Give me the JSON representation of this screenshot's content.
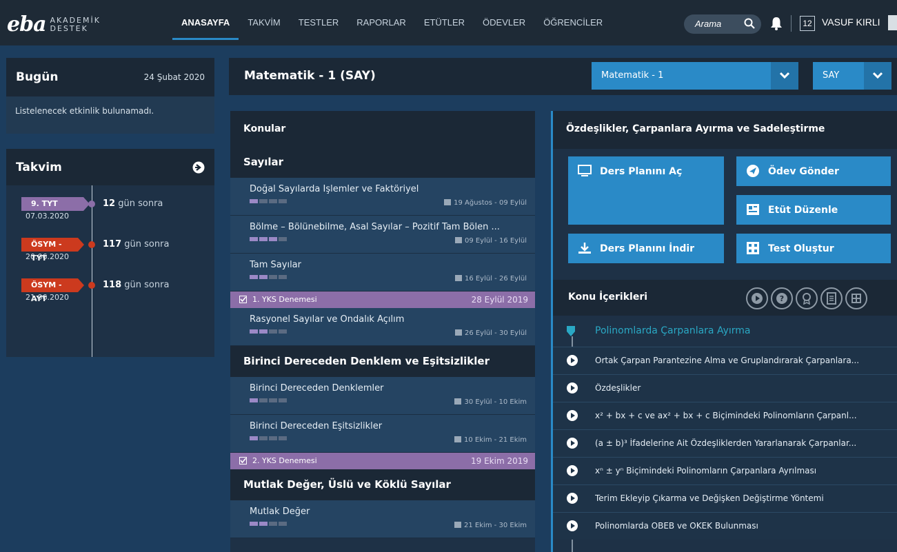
{
  "logo": {
    "mark": "eba",
    "line1": "AKADEMİK",
    "line2": "DESTEK"
  },
  "nav": [
    "ANASAYFA",
    "TAKVİM",
    "TESTLER",
    "RAPORLAR",
    "ETÜTLER",
    "ÖDEVLER",
    "ÖĞRENCİLER"
  ],
  "header": {
    "search_label": "Arama",
    "badge": "12",
    "username": "VASUF KIRLI"
  },
  "today": {
    "title": "Bugün",
    "date": "24 Şubat 2020",
    "empty": "Listelenecek etkinlik bulunamadı."
  },
  "takvim": {
    "title": "Takvim",
    "events": [
      {
        "tag": "9. TYT",
        "date": "07.03.2020",
        "days_num": "12",
        "days_suffix": "gün sonra",
        "color": "#8c6ea8"
      },
      {
        "tag": "ÖSYM - TYT",
        "date": "20.06.2020",
        "days_num": "117",
        "days_suffix": "gün sonra",
        "color": "#cc3a1e"
      },
      {
        "tag": "ÖSYM - AYT",
        "date": "21.06.2020",
        "days_num": "118",
        "days_suffix": "gün sonra",
        "color": "#cc3a1e"
      }
    ]
  },
  "subject": {
    "title": "Matematik - 1 (SAY)",
    "select1": "Matematik - 1",
    "select2": "SAY"
  },
  "konular": {
    "title": "Konular",
    "sections": [
      {
        "title": "Sayılar",
        "items": [
          {
            "type": "topic",
            "name": "Doğal Sayılarda İşlemler ve Faktöriyel",
            "progress": 1,
            "date": "19 Ağustos - 09 Eylül"
          },
          {
            "type": "topic",
            "name": "Bölme – Bölünebilme, Asal Sayılar – Pozitif Tam Bölen ...",
            "progress": 3,
            "date": "09 Eylül - 16 Eylül"
          },
          {
            "type": "topic",
            "name": "Tam Sayılar",
            "progress": 2,
            "date": "16 Eylül - 26 Eylül"
          },
          {
            "type": "exam",
            "name": "1. YKS Denemesi",
            "date": "28 Eylül 2019"
          },
          {
            "type": "topic",
            "name": "Rasyonel Sayılar ve Ondalık Açılım",
            "progress": 2,
            "date": "26 Eylül - 30 Eylül"
          }
        ]
      },
      {
        "title": "Birinci Dereceden Denklem ve Eşitsizlikler",
        "items": [
          {
            "type": "topic",
            "name": "Birinci Dereceden Denklemler",
            "progress": 1,
            "date": "30 Eylül - 10 Ekim"
          },
          {
            "type": "topic",
            "name": "Birinci Dereceden Eşitsizlikler",
            "progress": 1,
            "date": "10 Ekim - 21 Ekim"
          },
          {
            "type": "exam",
            "name": "2. YKS Denemesi",
            "date": "19 Ekim 2019"
          }
        ]
      },
      {
        "title": "Mutlak Değer, Üslü ve Köklü Sayılar",
        "items": [
          {
            "type": "topic",
            "name": "Mutlak Değer",
            "progress": 2,
            "date": "21 Ekim - 30 Ekim"
          }
        ]
      }
    ]
  },
  "detail": {
    "title": "Özdeşlikler, Çarpanlara Ayırma ve Sadeleştirme",
    "actions": {
      "open_plan": "Ders Planını Aç",
      "send_hw": "Ödev Gönder",
      "etut": "Etüt Düzenle",
      "download_plan": "Ders Planını İndir",
      "create_test": "Test Oluştur"
    },
    "contents_title": "Konu İçerikleri",
    "group": "Polinomlarda Çarpanlara Ayırma",
    "items": [
      "Ortak Çarpan Parantezine Alma ve Gruplandırarak Çarpanlara...",
      "Özdeşlikler",
      "x² + bx + c  ve ax² + bx + c Biçimindeki Polinomların Çarpanl...",
      "(a ± b)³ İfadelerine Ait Özdeşliklerden Yararlanarak Çarpanlar...",
      "xⁿ ± yⁿ Biçimindeki Polinomların Çarpanlara Ayrılması",
      "Terim Ekleyip Çıkarma ve Değişken Değiştirme Yöntemi",
      "Polinomlarda OBEB ve OKEK Bulunması"
    ]
  },
  "colors": {
    "accent": "#2a8ac7",
    "purple": "#8c6ea8",
    "red": "#cc3a1e",
    "teal": "#2aa8c4"
  }
}
